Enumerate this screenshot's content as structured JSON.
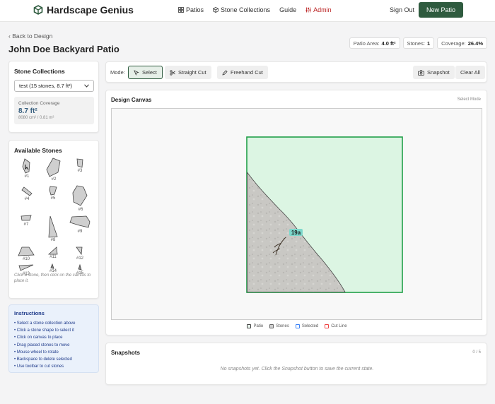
{
  "header": {
    "app_name": "Hardscape Genius",
    "nav": [
      {
        "label": "Patios",
        "icon": "grid-icon"
      },
      {
        "label": "Stone Collections",
        "icon": "box-icon"
      },
      {
        "label": "Guide",
        "icon": ""
      },
      {
        "label": "Admin",
        "icon": "sliders-icon"
      }
    ],
    "sign_out": "Sign Out",
    "new_patio": "New Patio",
    "accent_color": "#2f5b3f",
    "admin_color": "#b91c1c"
  },
  "page": {
    "back_link": "Back to Design",
    "title": "John Doe Backyard Patio",
    "stats": [
      {
        "label": "Patio Area:",
        "value": "4.0 ft²"
      },
      {
        "label": "Stones:",
        "value": "1"
      },
      {
        "label": "Coverage:",
        "value": "26.4%"
      }
    ]
  },
  "sidebar": {
    "collections_title": "Stone Collections",
    "selected_collection": "test (15 stones, 8.7 ft²)",
    "coverage_label": "Collection Coverage",
    "coverage_value": "8.7 ft²",
    "coverage_sub": "8080 cm² / 0.81 m²",
    "available_title": "Available Stones",
    "stones": [
      "#1",
      "#2",
      "#3",
      "#4",
      "#5",
      "#6",
      "#7",
      "#8",
      "#9",
      "#10",
      "#11",
      "#12",
      "#13",
      "#14",
      "#15"
    ],
    "hint": "Click a stone, then click on the canvas to place it."
  },
  "instructions": {
    "title": "Instructions",
    "items": [
      "Select a stone collection above",
      "Click a stone shape to select it",
      "Click on canvas to place",
      "Drag placed stones to move",
      "Mouse wheel to rotate",
      "Backspace to delete selected",
      "Use toolbar to cut stones"
    ]
  },
  "toolbar": {
    "mode_label": "Mode:",
    "select": "Select",
    "straight_cut": "Straight Cut",
    "freehand_cut": "Freehand Cut",
    "snapshot": "Snapshot",
    "clear_all": "Clear All"
  },
  "canvas": {
    "title": "Design Canvas",
    "mode_text": "Select Mode",
    "stone_label": "19a",
    "legend": [
      "Patio",
      "Stones",
      "Selected",
      "Cut Line"
    ],
    "colors": {
      "patio_fill": "#dcf5e3",
      "patio_stroke": "#22a049",
      "selected": "#3b82f6",
      "cut_line": "#ef4444"
    }
  },
  "snapshots": {
    "title": "Snapshots",
    "count": "0 / 5",
    "empty": "No snapshots yet. Click the Snapshot button to save the current state."
  }
}
